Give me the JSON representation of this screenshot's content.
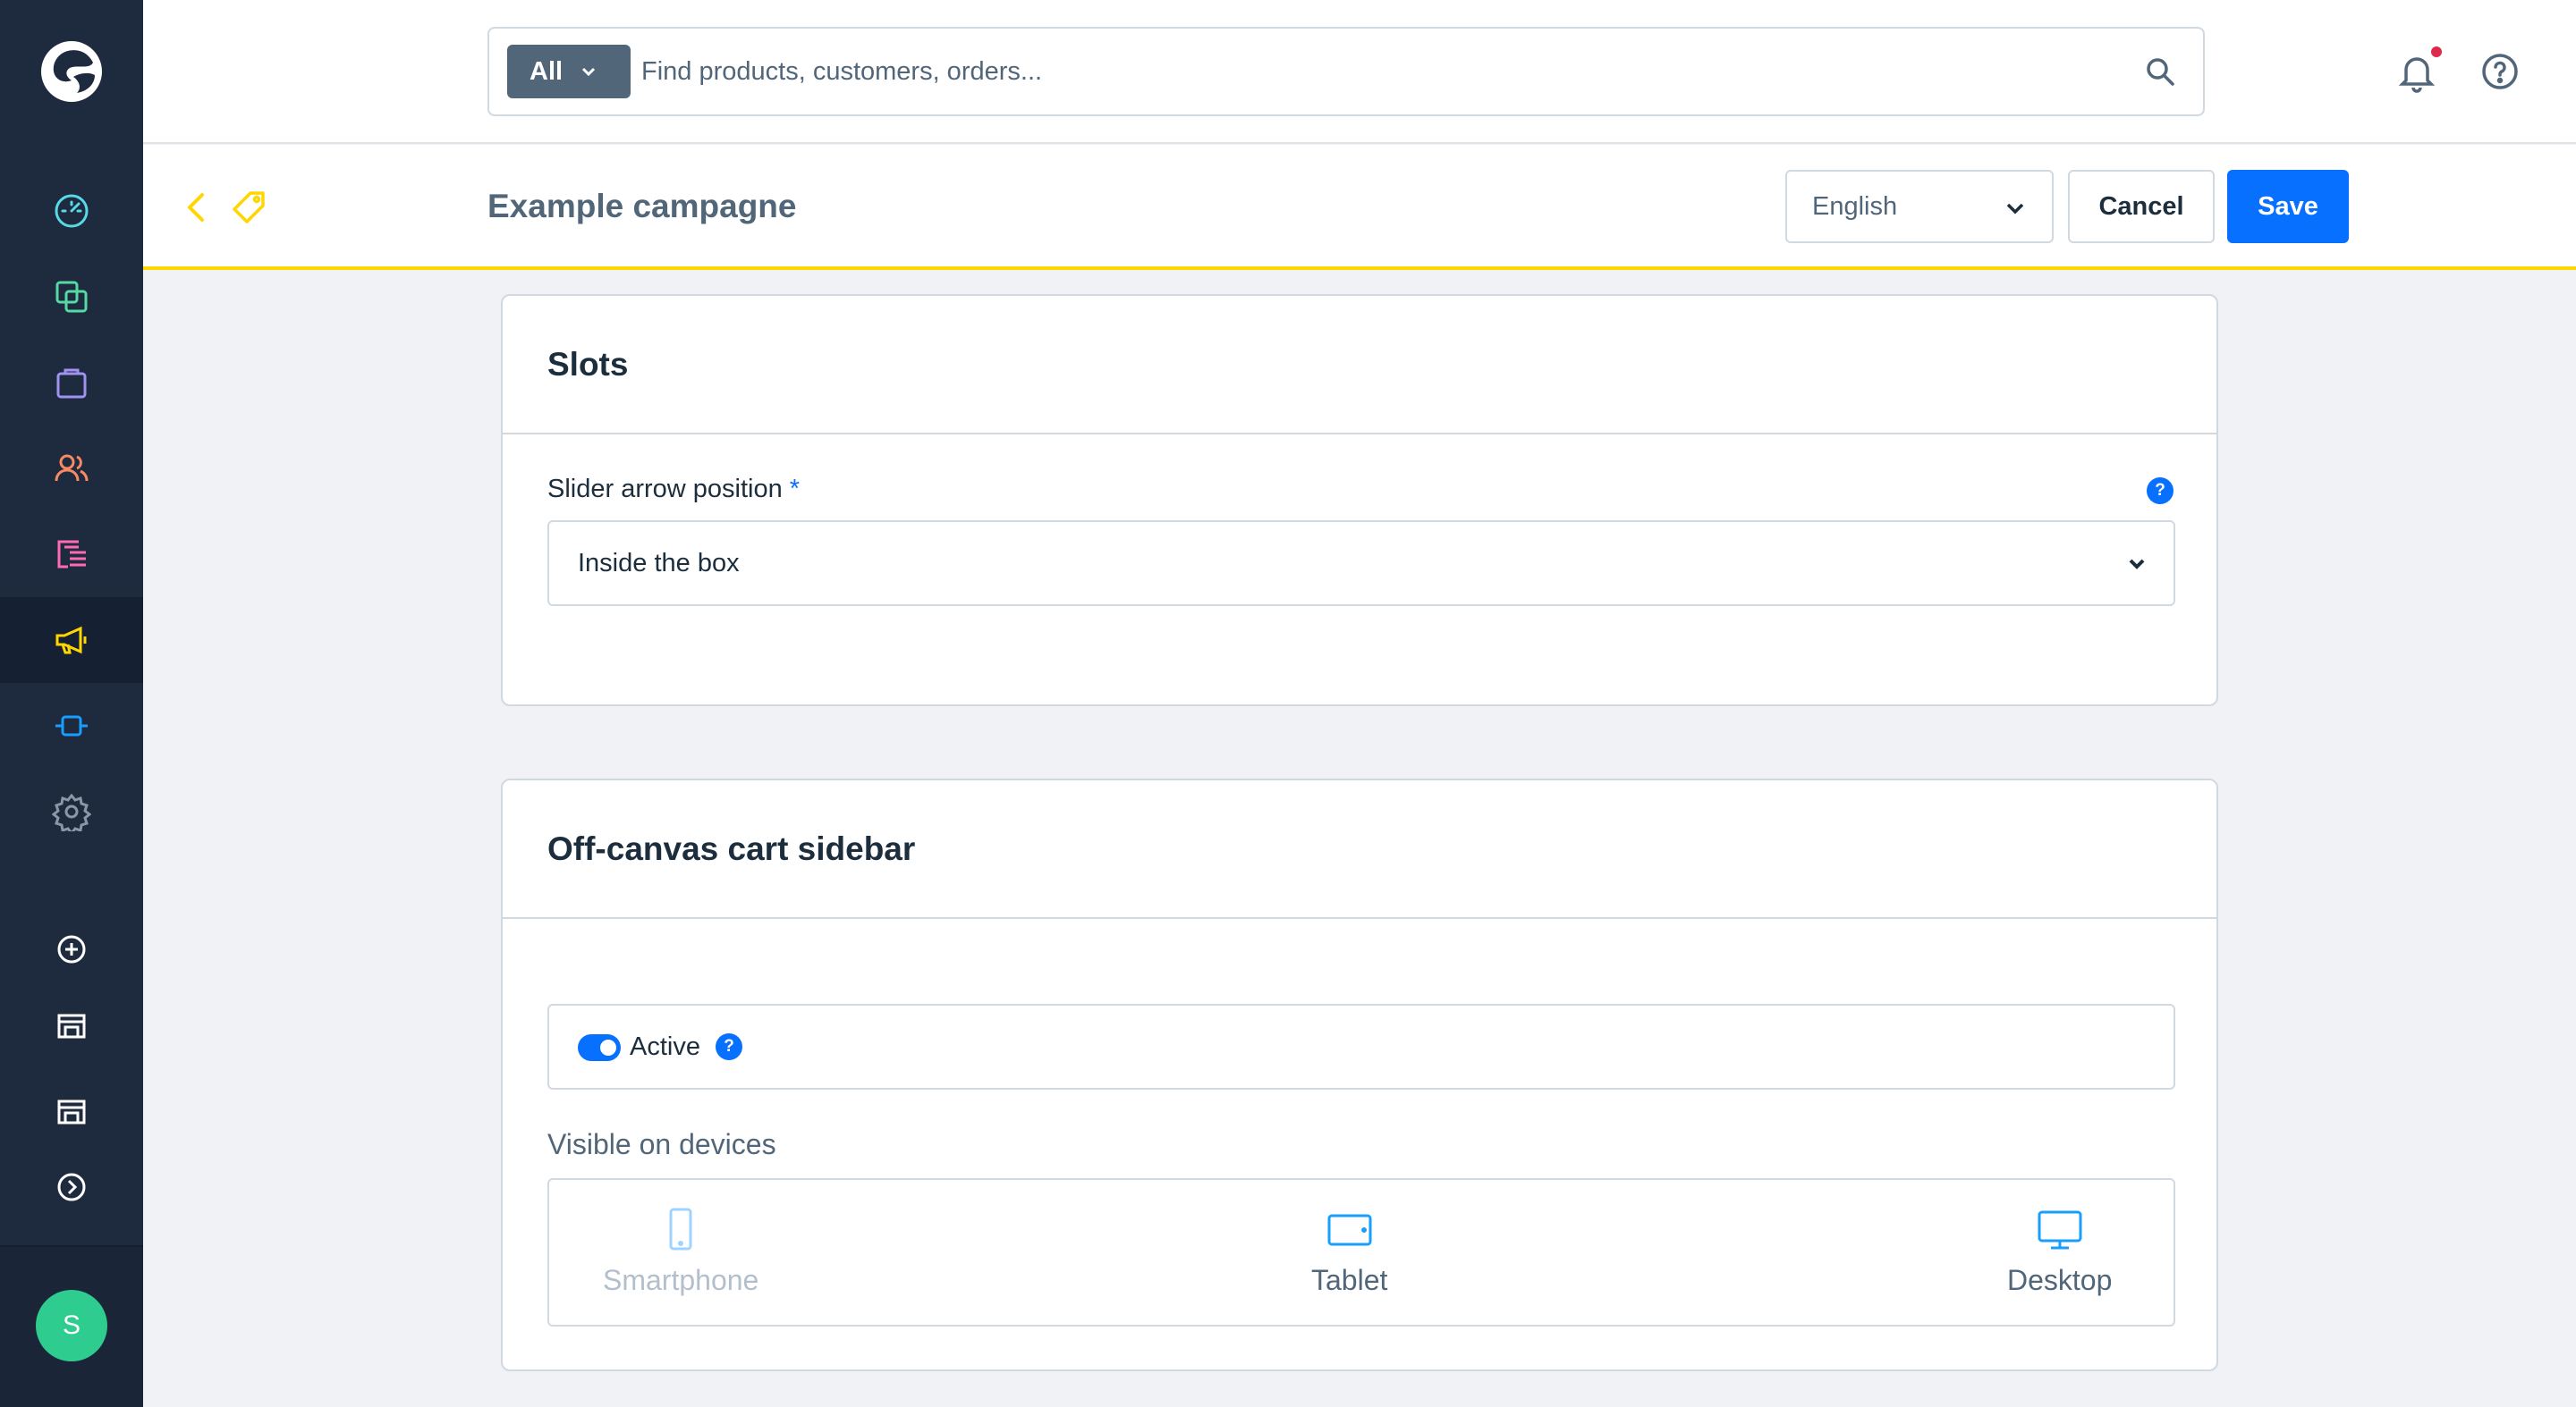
{
  "topbar": {
    "search_type": "All",
    "search_placeholder": "Find products, customers, orders..."
  },
  "smartbar": {
    "title": "Example campagne",
    "language": "English",
    "cancel_label": "Cancel",
    "save_label": "Save"
  },
  "sidebar": {
    "items": [
      {
        "icon": "dashboard-icon",
        "color": "#57d9e8"
      },
      {
        "icon": "catalogues-icon",
        "color": "#57d9a3"
      },
      {
        "icon": "orders-icon",
        "color": "#a092f0"
      },
      {
        "icon": "customers-icon",
        "color": "#f88962"
      },
      {
        "icon": "content-icon",
        "color": "#ff68b4"
      },
      {
        "icon": "marketing-icon",
        "color": "#ffd700"
      },
      {
        "icon": "extensions-icon",
        "color": "#189eff"
      },
      {
        "icon": "settings-icon",
        "color": "#8b97a7"
      },
      {
        "icon": "add-sales-channel-icon",
        "color": "#ffffff"
      },
      {
        "icon": "storefront-icon",
        "color": "#ffffff"
      },
      {
        "icon": "headless-icon",
        "color": "#ffffff"
      },
      {
        "icon": "expand-icon",
        "color": "#ffffff"
      }
    ],
    "avatar_initial": "S"
  },
  "slots_card": {
    "title": "Slots",
    "field_label": "Slider arrow position",
    "required_mark": "*",
    "field_value": "Inside the box"
  },
  "offcanvas_card": {
    "title": "Off-canvas cart sidebar",
    "active_label": "Active",
    "active_value": true,
    "devices_label": "Visible on devices",
    "devices": [
      {
        "label": "Smartphone",
        "enabled": false
      },
      {
        "label": "Tablet",
        "enabled": true
      },
      {
        "label": "Desktop",
        "enabled": true
      }
    ]
  },
  "help_glyph": "?",
  "colors": {
    "primary": "#0870ff",
    "sidebar_bg": "#1e2b3f",
    "accent_marketing": "#ffd700",
    "notification": "#de294c"
  }
}
